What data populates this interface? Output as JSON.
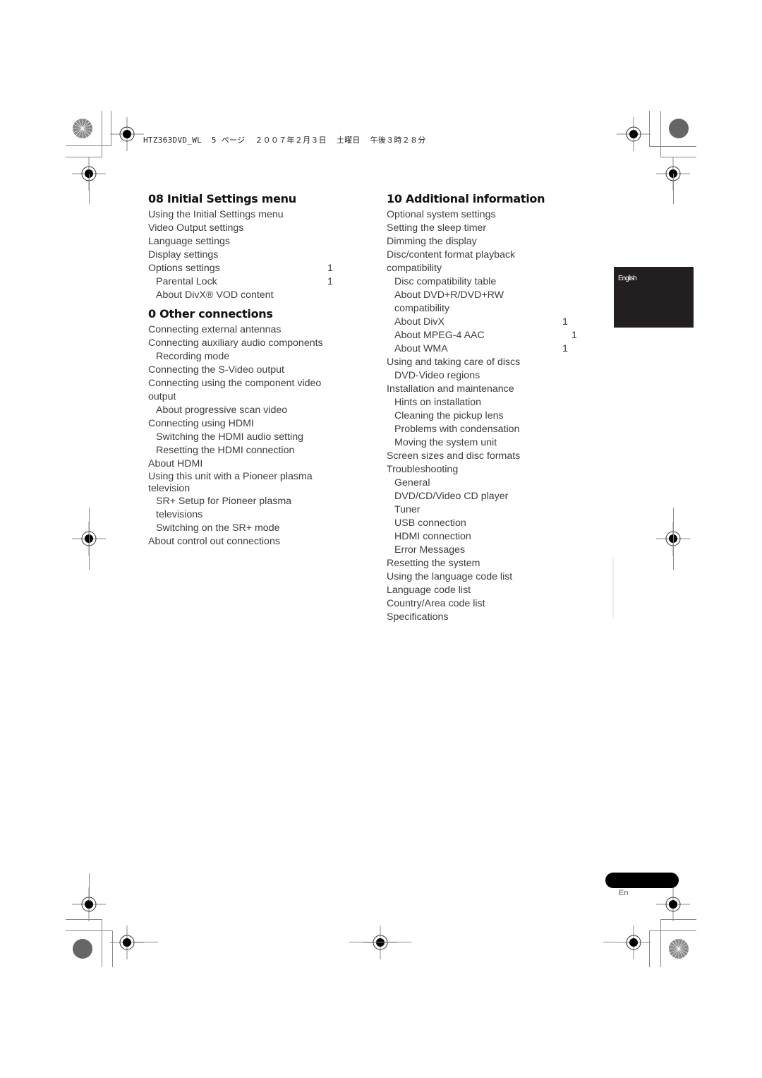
{
  "header": {
    "print_info": "HTZ363DVD_WL  5 ページ  ２００７年２月３日  土曜日  午後３時２８分"
  },
  "left_column": {
    "sections": [
      {
        "title": "08 Initial Settings menu",
        "entries": [
          {
            "label": "Using the Initial Settings menu",
            "page": ""
          },
          {
            "label": "Video Output settings",
            "page": ""
          },
          {
            "label": "Language settings",
            "page": ""
          },
          {
            "label": "Display settings",
            "page": ""
          },
          {
            "label": "Options settings",
            "page": "1"
          },
          {
            "label": "Parental Lock",
            "page": "1"
          },
          {
            "label": "About DivX® VOD content",
            "page": ""
          }
        ]
      },
      {
        "title": "0  Other connections",
        "entries": [
          {
            "label": "Connecting external antennas"
          },
          {
            "label": "Connecting auxiliary audio components"
          },
          {
            "label": "Recording mode"
          },
          {
            "label": "Connecting the S-Video output"
          },
          {
            "label": "Connecting using the component video output"
          },
          {
            "label": "About progressive scan video"
          },
          {
            "label": "Connecting using HDMI"
          },
          {
            "label": "Switching the HDMI audio setting"
          },
          {
            "label": "Resetting the HDMI connection"
          },
          {
            "label": "About HDMI"
          },
          {
            "label": "Using this unit with a Pioneer plasma television"
          },
          {
            "label": "SR+ Setup for Pioneer plasma televisions"
          },
          {
            "label": "Switching on the SR+ mode"
          },
          {
            "label": "About control out connections"
          }
        ]
      }
    ]
  },
  "right_column": {
    "sections": [
      {
        "title": "10 Additional information",
        "entries": [
          {
            "label": "Optional system settings"
          },
          {
            "label": "Setting the sleep timer"
          },
          {
            "label": "Dimming the display"
          },
          {
            "label": "Disc/content format playback compatibility"
          },
          {
            "label": "Disc compatibility table"
          },
          {
            "label": "About DVD+R/DVD+RW compatibility"
          },
          {
            "label": "About DivX",
            "page": "1"
          },
          {
            "label": "About MPEG-4 AAC",
            "page": "1"
          },
          {
            "label": "About WMA",
            "page": "1"
          },
          {
            "label": "Using and taking care of discs"
          },
          {
            "label": "DVD-Video regions"
          },
          {
            "label": "Installation and maintenance"
          },
          {
            "label": "Hints on installation"
          },
          {
            "label": "Cleaning the pickup lens"
          },
          {
            "label": "Problems with condensation"
          },
          {
            "label": "Moving the system unit"
          },
          {
            "label": "Screen sizes and disc formats"
          },
          {
            "label": "Troubleshooting"
          },
          {
            "label": "General"
          },
          {
            "label": "DVD/CD/Video CD player"
          },
          {
            "label": "Tuner"
          },
          {
            "label": "USB connection"
          },
          {
            "label": "HDMI connection"
          },
          {
            "label": "Error Messages"
          },
          {
            "label": "Resetting the system"
          },
          {
            "label": "Using the language code list"
          },
          {
            "label": "Language code list"
          },
          {
            "label": "Country/Area code list"
          },
          {
            "label": "Specifications"
          }
        ]
      }
    ]
  },
  "side_tab": {
    "label": "English"
  },
  "footer": {
    "page_number": "",
    "language": "En"
  }
}
